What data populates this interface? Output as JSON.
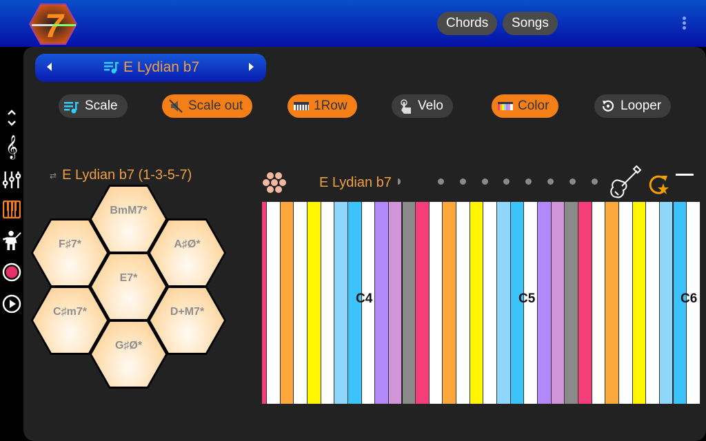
{
  "topbar": {
    "logo_label": "7",
    "buttons": [
      {
        "label": "Chords"
      },
      {
        "label": "Songs"
      }
    ],
    "menu_icon": "more-vertical-icon"
  },
  "sidebar": {
    "items": [
      {
        "icon": "expand-collapse-icon",
        "active": false
      },
      {
        "icon": "treble-clef-icon",
        "active": false
      },
      {
        "icon": "mixer-sliders-icon",
        "active": false
      },
      {
        "icon": "piano-icon",
        "active": true
      },
      {
        "icon": "conductor-icon",
        "active": false
      },
      {
        "icon": "record-icon",
        "active": false
      },
      {
        "icon": "play-icon",
        "active": false
      }
    ]
  },
  "scale_selector": {
    "title": "E Lydian b7",
    "icon": "playlist-music-icon"
  },
  "toolbar": {
    "buttons": [
      {
        "label": "Scale",
        "icon": "playlist-music-icon",
        "active": false
      },
      {
        "label": "Scale out",
        "icon": "mute-icon",
        "active": true
      },
      {
        "label": "1Row",
        "icon": "keyboard-icon",
        "active": true
      },
      {
        "label": "Velo",
        "icon": "touch-icon",
        "active": false
      },
      {
        "label": "Color",
        "icon": "color-bars-icon",
        "active": true
      },
      {
        "label": "Looper",
        "icon": "looper-icon",
        "active": false
      }
    ]
  },
  "chords": {
    "title": "E Lydian b7 (1-3-5-7)",
    "swap_icon": "swap-icon",
    "hexes": [
      {
        "label": "BmM7*"
      },
      {
        "label": "F♯7*"
      },
      {
        "label": "A♯Ø*"
      },
      {
        "label": "E7*"
      },
      {
        "label": "C♯m7*"
      },
      {
        "label": "D+M7*"
      },
      {
        "label": "G♯Ø*"
      }
    ]
  },
  "keyboard": {
    "title": "E Lydian b7",
    "page_dots": 9,
    "octave_labels": [
      "C4",
      "C5",
      "C6"
    ],
    "colors": {
      "pink": "#f53d7a",
      "white": "#ffffff",
      "orange": "#fca83c",
      "yellow": "#fff700",
      "lightblue": "#8fd6fb",
      "skyblue": "#3dc3fb",
      "purple": "#b288fb",
      "lavender": "#cf95d8",
      "gray": "#8a8a8a"
    },
    "stripes": [
      "white",
      "orange",
      "white",
      "yellow",
      "white",
      "lightblue",
      "skyblue",
      "white",
      "purple",
      "lavender",
      "gray",
      "pink",
      "white",
      "orange",
      "white",
      "yellow",
      "white",
      "lightblue",
      "skyblue",
      "white",
      "purple",
      "lavender",
      "gray",
      "pink",
      "white",
      "orange",
      "white",
      "yellow",
      "white",
      "lightblue",
      "skyblue",
      "white"
    ]
  },
  "accent_color": "#f57f17"
}
